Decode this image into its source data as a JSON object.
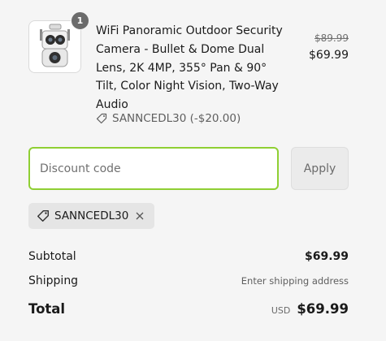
{
  "product": {
    "quantity": "1",
    "title": "WiFi Panoramic Outdoor Security Camera - Bullet & Dome Dual Lens, 2K 4MP, 355° Pan & 90° Tilt, Color Night Vision, Two-Way Audio",
    "discount_text": "SANNCEDL30 (-$20.00)",
    "old_price": "$89.99",
    "new_price": "$69.99"
  },
  "discount_form": {
    "placeholder": "Discount code",
    "apply_label": "Apply"
  },
  "applied_code": {
    "label": "SANNCEDL30"
  },
  "summary": {
    "subtotal_label": "Subtotal",
    "subtotal_value": "$69.99",
    "shipping_label": "Shipping",
    "shipping_value": "Enter shipping address",
    "total_label": "Total",
    "currency": "USD",
    "total_value": "$69.99"
  },
  "colors": {
    "focus_border": "#8fcf33",
    "background": "#f5f5f5"
  },
  "icons": [
    "tag-icon",
    "close-icon",
    "camera-product-icon"
  ]
}
